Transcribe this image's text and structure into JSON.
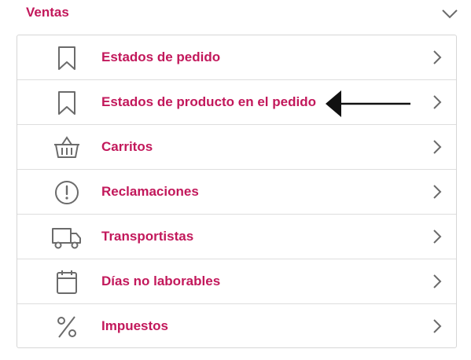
{
  "section": {
    "title": "Ventas",
    "toggle_icon": "chevron-down-icon"
  },
  "menu": {
    "items": [
      {
        "label": "Estados de pedido",
        "icon": "bookmark-icon"
      },
      {
        "label": "Estados de producto en el pedido",
        "icon": "bookmark-icon"
      },
      {
        "label": "Carritos",
        "icon": "basket-icon"
      },
      {
        "label": "Reclamaciones",
        "icon": "alert-circle-icon"
      },
      {
        "label": "Transportistas",
        "icon": "truck-icon"
      },
      {
        "label": "Días no laborables",
        "icon": "calendar-icon"
      },
      {
        "label": "Impuestos",
        "icon": "percent-icon"
      }
    ],
    "item_chevron_icon": "chevron-right-icon"
  },
  "annotation": {
    "icon": "arrow-left-icon"
  },
  "colors": {
    "accent": "#c2185b",
    "icon": "#6b6b6b",
    "border": "#d6d6d6",
    "annotation_arrow": "#111111"
  }
}
